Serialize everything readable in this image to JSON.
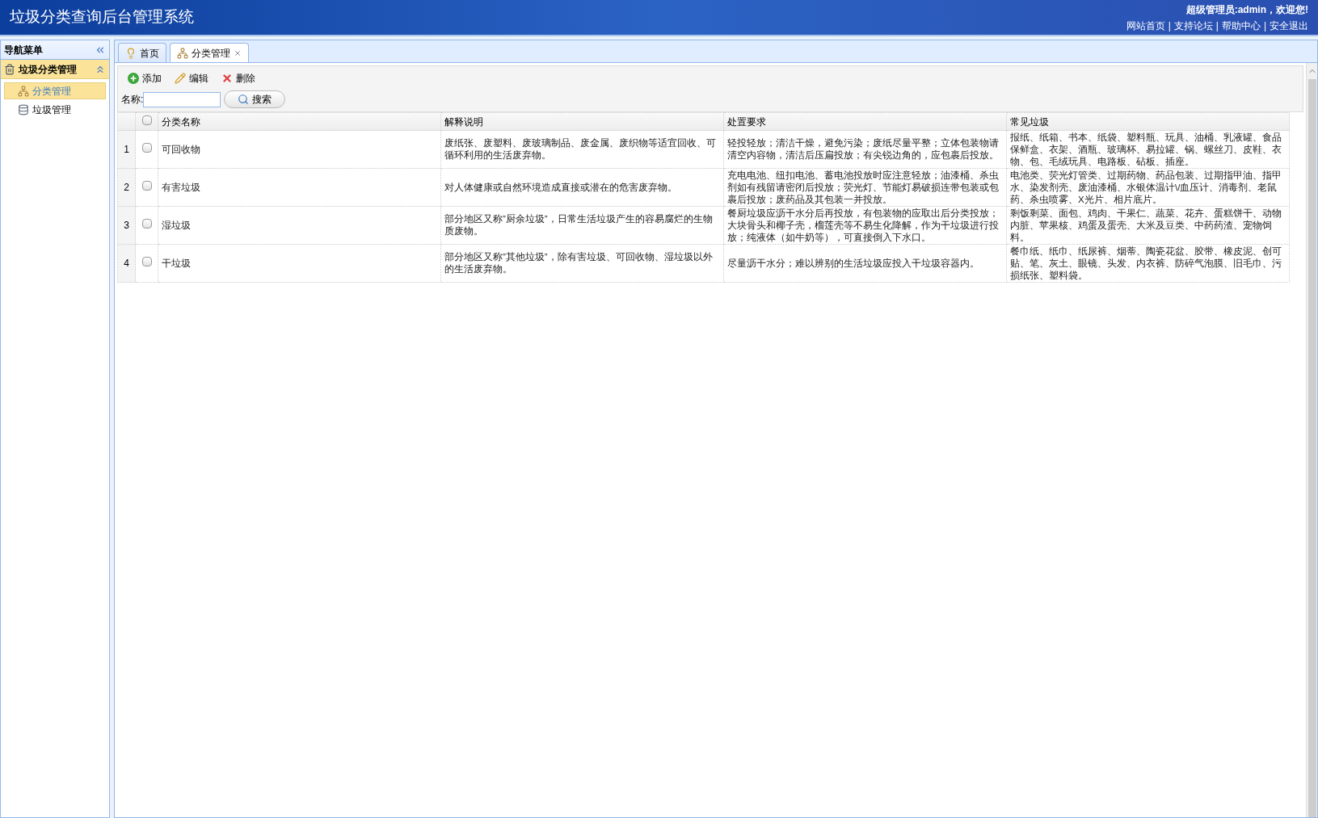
{
  "header": {
    "title": "垃圾分类查询后台管理系统",
    "greeting": "超级管理员:admin，欢迎您!",
    "links": [
      "网站首页",
      "支持论坛",
      "帮助中心",
      "安全退出"
    ],
    "separator": "|"
  },
  "sidebar": {
    "title": "导航菜单",
    "groups": [
      {
        "label": "垃圾分类管理",
        "expanded": true,
        "items": [
          {
            "label": "分类管理",
            "kind": "sitemap",
            "selected": true
          },
          {
            "label": "垃圾管理",
            "kind": "bin",
            "selected": false
          }
        ]
      }
    ]
  },
  "tabs": [
    {
      "label": "首页",
      "kind": "bulb",
      "selected": false,
      "closable": false
    },
    {
      "label": "分类管理",
      "kind": "sitemap",
      "selected": true,
      "closable": true
    }
  ],
  "toolbar": [
    {
      "kind": "add",
      "label": "添加"
    },
    {
      "kind": "edit",
      "label": "编辑"
    },
    {
      "kind": "delete",
      "label": "删除"
    }
  ],
  "search": {
    "label": "名称:",
    "button": "搜索"
  },
  "table": {
    "all_checked": false,
    "columns": [
      "分类名称",
      "解释说明",
      "处置要求",
      "常见垃圾"
    ],
    "rows": [
      {
        "number": "1",
        "checked": false,
        "cells": [
          "可回收物",
          "废纸张、废塑料、废玻璃制品、废金属、废织物等适宜回收、可循环利用的生活废弃物。",
          "轻投轻放；清洁干燥，避免污染；废纸尽量平整；立体包装物请清空内容物，清洁后压扁投放；有尖锐边角的，应包裹后投放。",
          "报纸、纸箱、书本、纸袋、塑料瓶、玩具、油桶、乳液罐、食品保鲜盒、衣架、酒瓶、玻璃杯、易拉罐、锅、螺丝刀、皮鞋、衣物、包、毛绒玩具、电路板、砧板、插座。"
        ]
      },
      {
        "number": "2",
        "checked": false,
        "cells": [
          "有害垃圾",
          "对人体健康或自然环境造成直接或潜在的危害废弃物。",
          "充电电池、纽扣电池、蓄电池投放时应注意轻放；油漆桶、杀虫剂如有残留请密闭后投放；荧光灯、节能灯易破损连带包装或包裹后投放；废药品及其包装一并投放。",
          "电池类、荧光灯管类、过期药物、药品包装、过期指甲油、指甲水、染发剂壳、废油漆桶、水银体温计\\/血压计、消毒剂、老鼠药、杀虫喷雾、X光片、相片底片。"
        ]
      },
      {
        "number": "3",
        "checked": false,
        "cells": [
          "湿垃圾",
          "部分地区又称”厨余垃圾”，日常生活垃圾产生的容易腐烂的生物质废物。",
          "餐厨垃圾应沥干水分后再投放，有包装物的应取出后分类投放；大块骨头和椰子壳，榴莲壳等不易生化降解，作为干垃圾进行投放；纯液体（如牛奶等），可直接倒入下水口。",
          "剩饭剩菜、面包、鸡肉、干果仁、蔬菜、花卉、蛋糕饼干、动物内脏、苹果核、鸡蛋及蛋壳、大米及豆类、中药药渣、宠物饲料。"
        ]
      },
      {
        "number": "4",
        "checked": false,
        "cells": [
          "干垃圾",
          "部分地区又称”其他垃圾”，除有害垃圾、可回收物、湿垃圾以外的生活废弃物。",
          "尽量沥干水分；难以辨别的生活垃圾应投入干垃圾容器内。",
          "餐巾纸、纸巾、纸尿裤、烟蒂、陶瓷花盆、胶带、橡皮泥、创可贴、笔、灰土、眼镜、头发、内衣裤、防碎气泡膜、旧毛巾、污损纸张、塑料袋。"
        ]
      }
    ]
  }
}
